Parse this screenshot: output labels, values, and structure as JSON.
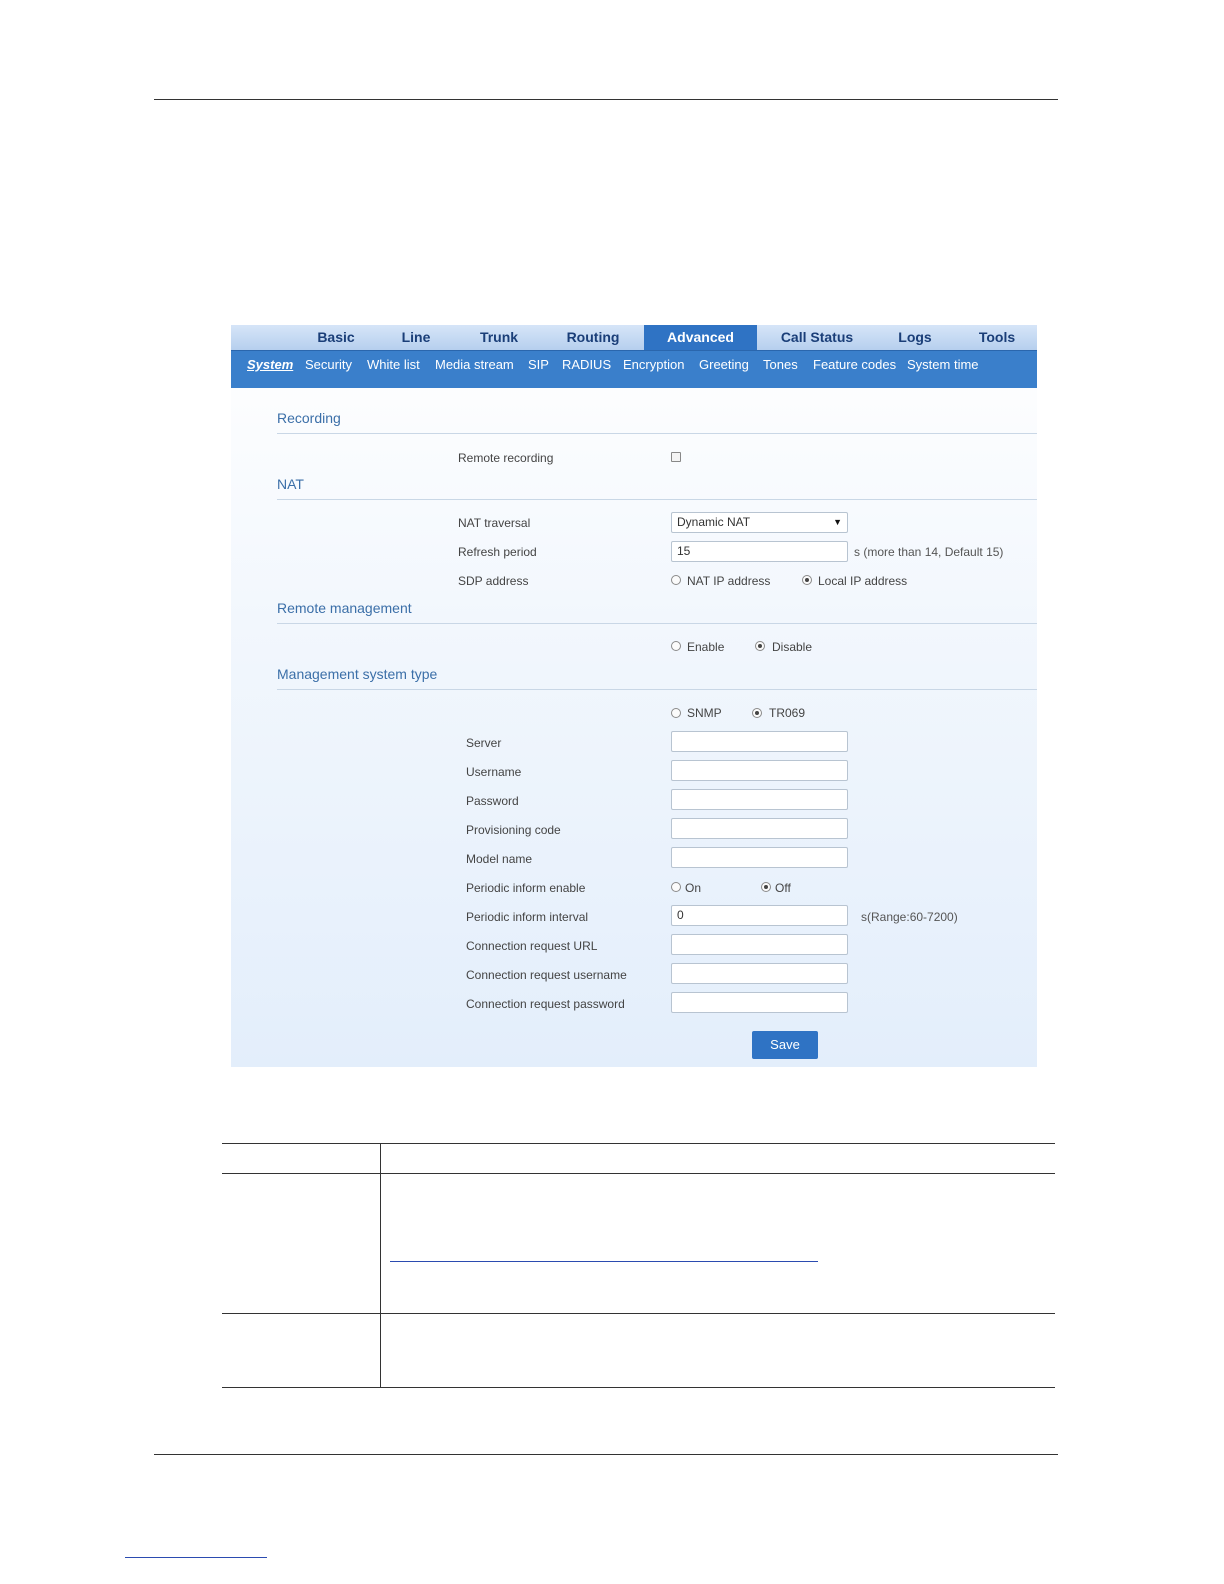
{
  "topnav": {
    "tabs": [
      "Basic",
      "Line",
      "Trunk",
      "Routing",
      "Advanced",
      "Call Status",
      "Logs",
      "Tools"
    ],
    "active": "Advanced"
  },
  "subnav": {
    "items": [
      "System",
      "Security",
      "White list",
      "Media stream",
      "SIP",
      "RADIUS",
      "Encryption",
      "Greeting",
      "Tones",
      "Feature codes",
      "System time"
    ],
    "active": "System"
  },
  "recording": {
    "title": "Recording",
    "remote_recording_label": "Remote recording",
    "remote_recording_checked": false
  },
  "nat": {
    "title": "NAT",
    "traversal_label": "NAT traversal",
    "traversal_value": "Dynamic NAT",
    "refresh_label": "Refresh period",
    "refresh_value": "15",
    "refresh_hint": "s (more than 14, Default 15)",
    "sdp_label": "SDP address",
    "sdp_options": [
      "NAT IP address",
      "Local IP address"
    ],
    "sdp_selected": "Local IP address"
  },
  "remote_management": {
    "title": "Remote management",
    "options": [
      "Enable",
      "Disable"
    ],
    "selected": "Disable"
  },
  "management_type": {
    "title": "Management system type",
    "options": [
      "SNMP",
      "TR069"
    ],
    "selected": "TR069",
    "server_label": "Server",
    "server_value": "",
    "username_label": "Username",
    "username_value": "",
    "password_label": "Password",
    "password_value": "",
    "provisioning_label": "Provisioning code",
    "provisioning_value": "",
    "model_label": "Model name",
    "model_value": "",
    "periodic_enable_label": "Periodic inform enable",
    "periodic_enable_options": [
      "On",
      "Off"
    ],
    "periodic_enable_selected": "Off",
    "periodic_interval_label": "Periodic inform interval",
    "periodic_interval_value": "0",
    "periodic_interval_hint": "s(Range:60-7200)",
    "conn_url_label": "Connection request URL",
    "conn_url_value": "",
    "conn_user_label": "Connection request username",
    "conn_user_value": "",
    "conn_pass_label": "Connection request password",
    "conn_pass_value": ""
  },
  "save_label": "Save"
}
